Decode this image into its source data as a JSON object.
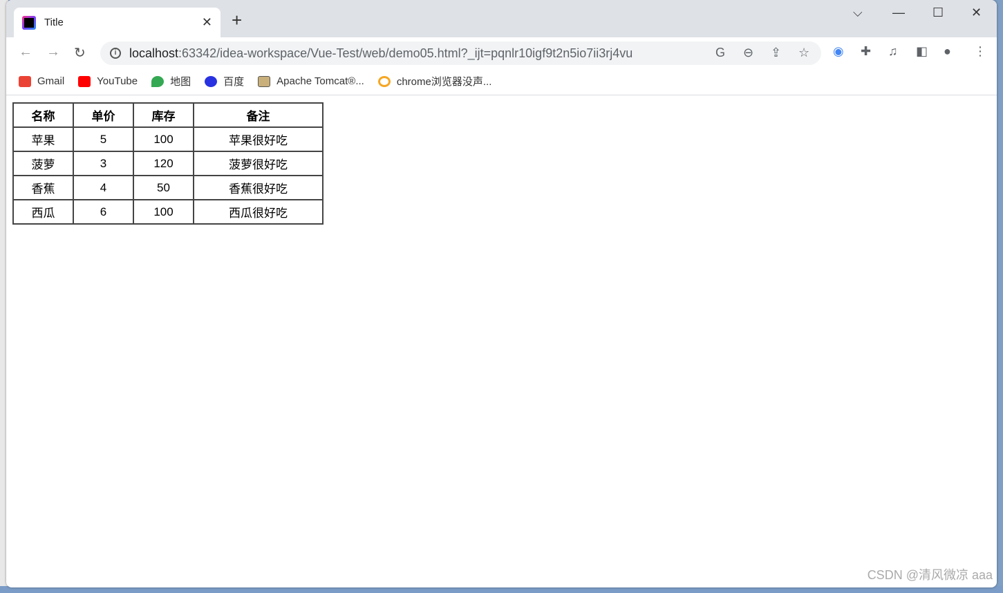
{
  "browser": {
    "tab_title": "Title",
    "url_host": "localhost",
    "url_rest": ":63342/idea-workspace/Vue-Test/web/demo05.html?_ijt=pqnlr10igf9t2n5io7ii3rj4vu"
  },
  "bookmarks": [
    {
      "label": "Gmail",
      "color": "#ea4335"
    },
    {
      "label": "YouTube",
      "color": "#ff0000"
    },
    {
      "label": "地图",
      "color": "#34a853"
    },
    {
      "label": "百度",
      "color": "#2932e1"
    },
    {
      "label": "Apache Tomcat®...",
      "color": "#8a6d3b"
    },
    {
      "label": "chrome浏览器没声...",
      "color": "#f5a623"
    }
  ],
  "table": {
    "headers": [
      "名称",
      "单价",
      "库存",
      "备注"
    ],
    "rows": [
      [
        "苹果",
        "5",
        "100",
        "苹果很好吃"
      ],
      [
        "菠萝",
        "3",
        "120",
        "菠萝很好吃"
      ],
      [
        "香蕉",
        "4",
        "50",
        "香蕉很好吃"
      ],
      [
        "西瓜",
        "6",
        "100",
        "西瓜很好吃"
      ]
    ]
  },
  "watermark": "CSDN @清风微凉 aaa"
}
